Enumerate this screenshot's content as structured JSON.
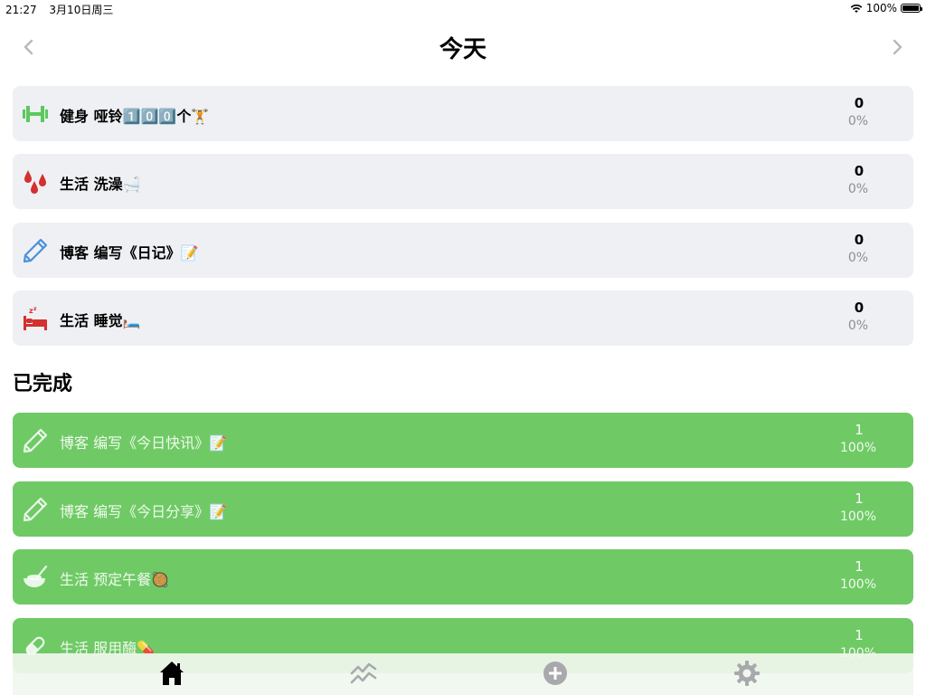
{
  "status_bar": {
    "time": "21:27",
    "date": "3月10日周三",
    "battery_text": "100%"
  },
  "header": {
    "title": "今天",
    "prev_icon": "chevron-left-icon",
    "next_icon": "chevron-right-icon"
  },
  "today_tasks": [
    {
      "title": "健身 哑铃1️⃣0️⃣0️⃣个🏋️",
      "count": "0",
      "percent": "0%",
      "icon": "dumbbell-icon",
      "icon_color": "#5cc95c"
    },
    {
      "title": "生活 洗澡🛁",
      "count": "0",
      "percent": "0%",
      "icon": "water-drops-icon",
      "icon_color": "#d3302f"
    },
    {
      "title": "博客 编写《日记》📝",
      "count": "0",
      "percent": "0%",
      "icon": "pencil-icon",
      "icon_color": "#4a90d9"
    },
    {
      "title": "生活 睡觉🛏️",
      "count": "0",
      "percent": "0%",
      "icon": "bed-sleep-icon",
      "icon_color": "#d3302f"
    }
  ],
  "completed_section": {
    "title": "已完成",
    "tasks": [
      {
        "title": "博客 编写《今日快讯》📝",
        "count": "1",
        "percent": "100%",
        "icon": "pencil-icon"
      },
      {
        "title": "博客 编写《今日分享》📝",
        "count": "1",
        "percent": "100%",
        "icon": "pencil-icon"
      },
      {
        "title": "生活 预定午餐🥘",
        "count": "1",
        "percent": "100%",
        "icon": "bowl-icon"
      },
      {
        "title": "生活 服用酶💊",
        "count": "1",
        "percent": "100%",
        "icon": "pill-icon"
      }
    ]
  },
  "tab_bar": {
    "items": [
      {
        "icon": "home-icon",
        "active": true
      },
      {
        "icon": "stats-chart-icon",
        "active": false
      },
      {
        "icon": "add-circle-icon",
        "active": false
      },
      {
        "icon": "settings-gear-icon",
        "active": false
      }
    ]
  },
  "colors": {
    "completed_bg": "#6fca65",
    "pending_bg": "#eff0f4",
    "inactive_icon": "#a8a8ad"
  }
}
